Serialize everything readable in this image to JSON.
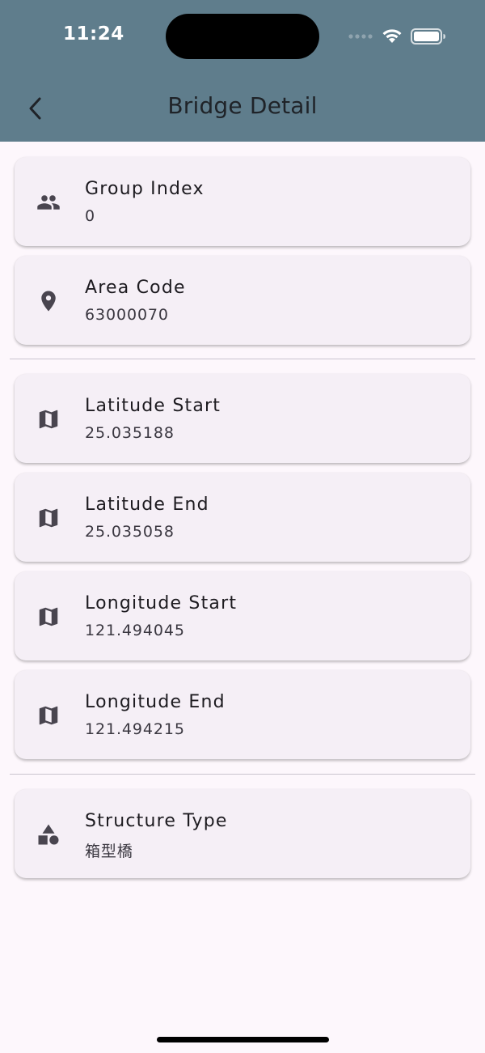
{
  "status_bar": {
    "time": "11:24"
  },
  "app_bar": {
    "title": "Bridge Detail"
  },
  "items": [
    {
      "label": "Group Index",
      "value": "0",
      "icon": "group-icon"
    },
    {
      "label": "Area Code",
      "value": "63000070",
      "icon": "location-pin-icon"
    },
    {
      "label": "Latitude Start",
      "value": "25.035188",
      "icon": "map-icon"
    },
    {
      "label": "Latitude End",
      "value": "25.035058",
      "icon": "map-icon"
    },
    {
      "label": "Longitude Start",
      "value": "121.494045",
      "icon": "map-icon"
    },
    {
      "label": "Longitude End",
      "value": "121.494215",
      "icon": "map-icon"
    },
    {
      "label": "Structure Type",
      "value": "箱型橋",
      "icon": "shapes-icon"
    }
  ],
  "colors": {
    "app_bar": "#5F7D8C",
    "background": "#FDF7FC",
    "card": "#F5EFF6",
    "icon": "#49454F"
  }
}
